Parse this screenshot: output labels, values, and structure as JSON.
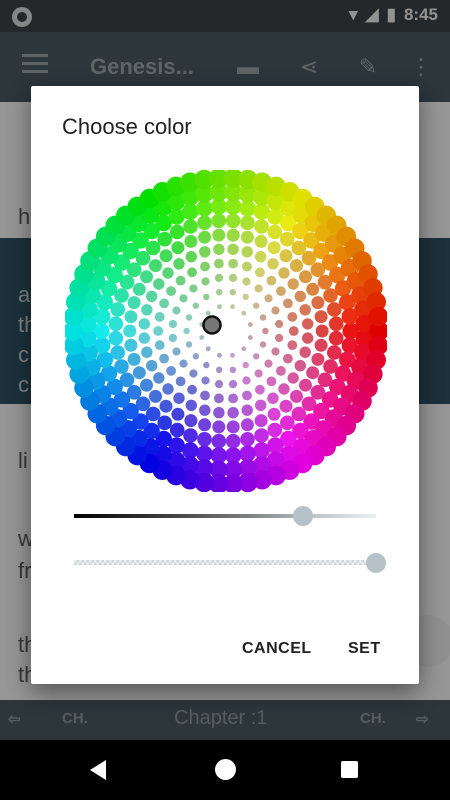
{
  "status_bar": {
    "time": "8:45"
  },
  "app_bar": {
    "title": "Genesis..."
  },
  "content": {
    "lines": [
      "h",
      "a",
      "th",
      "c",
      "c",
      "li",
      "w",
      "fr",
      "th",
      "th"
    ]
  },
  "bottom_nav": {
    "prev_label": "CH.",
    "chapter_label": "Chapter :1",
    "next_label": "CH."
  },
  "dialog": {
    "title": "Choose color",
    "cancel_label": "CANCEL",
    "set_label": "SET",
    "lightness_fraction": 0.76,
    "alpha_fraction": 1.0
  },
  "colors": {
    "dialog_bg": "#ffffff",
    "app_bar": "#47585f",
    "highlight": "#2e4f62"
  }
}
